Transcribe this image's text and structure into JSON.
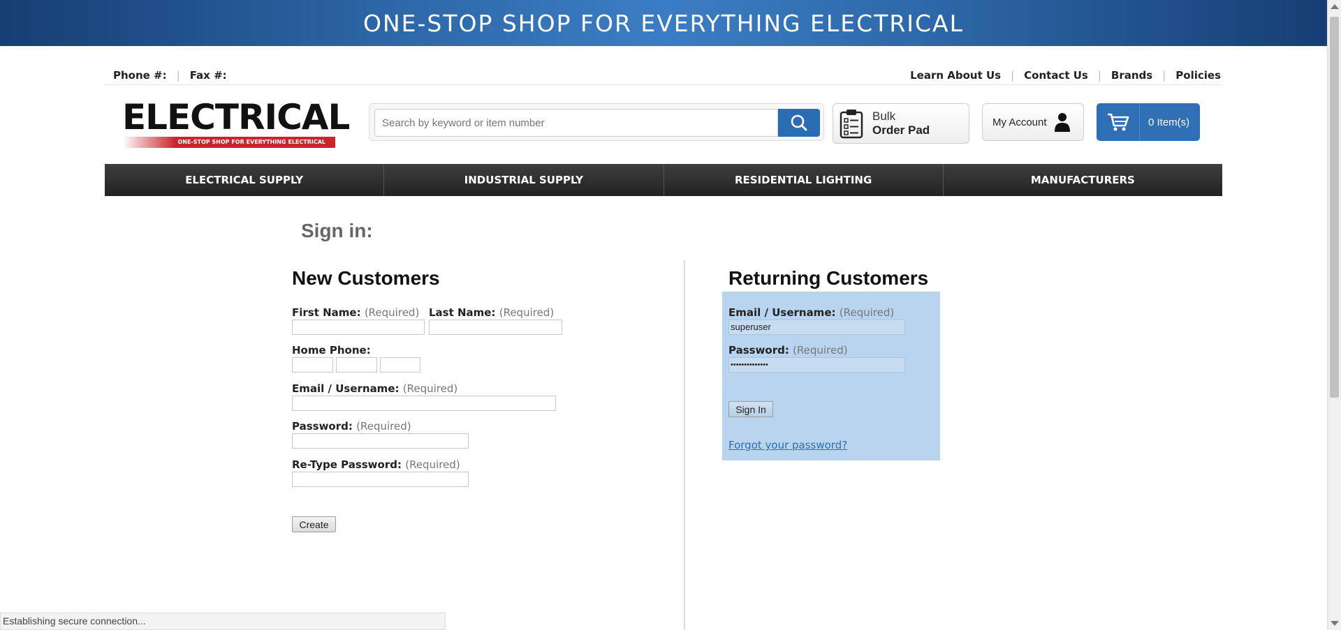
{
  "banner": {
    "text": "ONE-STOP SHOP FOR EVERYTHING ELECTRICAL"
  },
  "topbar": {
    "phone_label": "Phone #:",
    "fax_label": "Fax #:",
    "links": [
      "Learn About Us",
      "Contact Us",
      "Brands",
      "Policies"
    ]
  },
  "logo": {
    "word": "ELECTRICAL",
    "tagline": "ONE-STOP SHOP FOR EVERYTHING ELECTRICAL"
  },
  "search": {
    "placeholder": "Search by keyword or item number",
    "icon": "search-icon"
  },
  "bulk": {
    "line1": "Bulk",
    "line2": "Order Pad",
    "icon": "clipboard-icon"
  },
  "account": {
    "label": "My Account",
    "icon": "user-icon"
  },
  "cart": {
    "label": "0 Item(s)",
    "icon": "cart-icon"
  },
  "nav": [
    "ELECTRICAL SUPPLY",
    "INDUSTRIAL SUPPLY",
    "RESIDENTIAL LIGHTING",
    "MANUFACTURERS"
  ],
  "signin": {
    "title": "Sign in:"
  },
  "new_customers": {
    "heading": "New Customers",
    "first_name": "First Name:",
    "last_name": "Last Name:",
    "home_phone": "Home Phone:",
    "email": "Email / Username:",
    "password": "Password:",
    "retype": "Re-Type Password:",
    "required": "(Required)",
    "create_label": "Create"
  },
  "returning": {
    "heading": "Returning Customers",
    "email": "Email / Username:",
    "email_value": "superuser",
    "password": "Password:",
    "password_value": "••••••••••••••",
    "required": "(Required)",
    "signin_label": "Sign In",
    "forgot": "Forgot your password?"
  },
  "status_bar": {
    "text": "Establishing secure connection..."
  },
  "colors": {
    "banner": "#2d68a8",
    "accent_blue": "#2f6fb6",
    "highlight": "#b9d4ee",
    "nav_bg": "#2e2e2e",
    "logo_red": "#c9252a"
  }
}
